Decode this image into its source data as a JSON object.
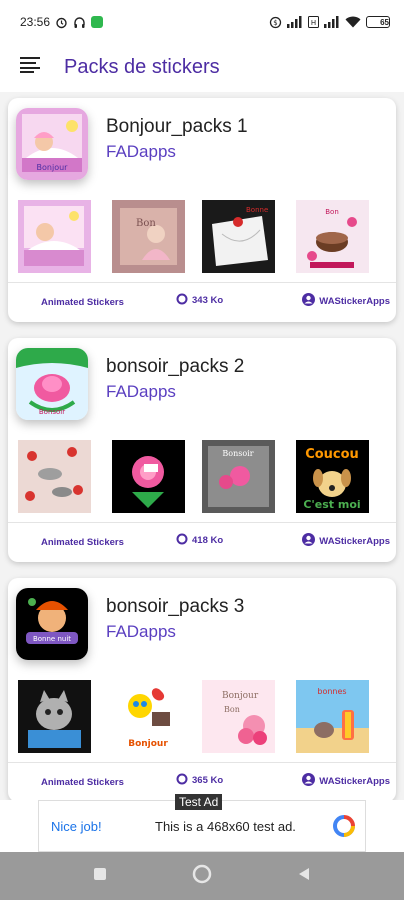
{
  "status_bar": {
    "time": "23:56",
    "icons": [
      "alarm-icon",
      "headphones-icon",
      "app-notification-icon",
      "data-saver-icon",
      "signal-icon",
      "volte-icon",
      "signal-icon-2",
      "wifi-icon",
      "battery-icon"
    ],
    "battery_level": "65"
  },
  "app_bar": {
    "title": "Packs de stickers",
    "menu_icon": "menu-icon"
  },
  "packs": [
    {
      "name": "Bonjour_packs 1",
      "publisher": "FADapps",
      "type_label": "Animated Stickers",
      "size": "343 Ko",
      "author": "WAStickerApps"
    },
    {
      "name": "bonsoir_packs 2",
      "publisher": "FADapps",
      "type_label": "Animated Stickers",
      "size": "418 Ko",
      "author": "WAStickerApps"
    },
    {
      "name": "bonsoir_packs 3",
      "publisher": "FADapps",
      "type_label": "Animated Stickers",
      "size": "365 Ko",
      "author": "WAStickerApps"
    }
  ],
  "ad": {
    "label": "Test Ad",
    "cta": "Nice job!",
    "text": "This is a 468x60 test ad."
  },
  "colors": {
    "accent": "#4d2da3",
    "publisher": "#5a3fc0",
    "nav_bar": "#9a9a9a"
  }
}
